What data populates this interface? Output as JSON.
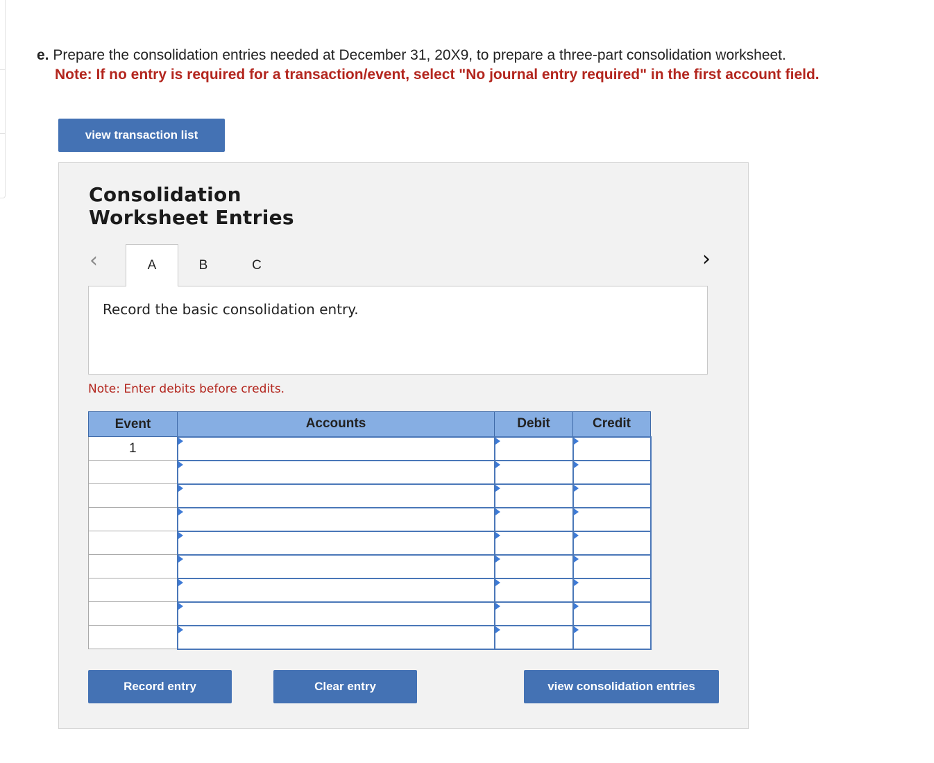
{
  "question": {
    "letter": "e.",
    "text": "Prepare the consolidation entries needed at December 31, 20X9, to prepare a three-part consolidation worksheet.",
    "note": "Note: If no entry is required for a transaction/event, select \"No journal entry required\" in the first account field."
  },
  "buttons": {
    "view_transaction_list": "view transaction list",
    "record_entry": "Record entry",
    "clear_entry": "Clear entry",
    "view_consolidation_entries": "view consolidation entries"
  },
  "panel": {
    "title_line1": "Consolidation",
    "title_line2": "Worksheet Entries",
    "prev_icon": "chevron-left-icon",
    "next_icon": "chevron-right-icon",
    "tabs": [
      {
        "label": "A",
        "active": true
      },
      {
        "label": "B",
        "active": false
      },
      {
        "label": "C",
        "active": false
      }
    ],
    "prompt": "Record the basic consolidation entry.",
    "note": "Note: Enter debits before credits."
  },
  "journal": {
    "headers": [
      "Event",
      "Accounts",
      "Debit",
      "Credit"
    ],
    "rows": [
      {
        "event": "1",
        "account": "",
        "debit": "",
        "credit": ""
      },
      {
        "event": "",
        "account": "",
        "debit": "",
        "credit": ""
      },
      {
        "event": "",
        "account": "",
        "debit": "",
        "credit": ""
      },
      {
        "event": "",
        "account": "",
        "debit": "",
        "credit": ""
      },
      {
        "event": "",
        "account": "",
        "debit": "",
        "credit": ""
      },
      {
        "event": "",
        "account": "",
        "debit": "",
        "credit": ""
      },
      {
        "event": "",
        "account": "",
        "debit": "",
        "credit": ""
      },
      {
        "event": "",
        "account": "",
        "debit": "",
        "credit": ""
      },
      {
        "event": "",
        "account": "",
        "debit": "",
        "credit": ""
      }
    ]
  },
  "colors": {
    "button": "#4472b4",
    "header": "#86aee3",
    "note_red": "#b3261e",
    "cell_border": "#4a77b8"
  }
}
